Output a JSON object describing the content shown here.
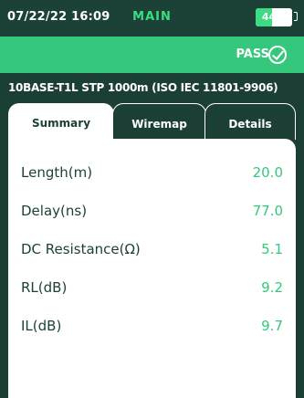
{
  "status_bar": {
    "datetime": "07/22/22 16:09",
    "mode": "MAIN",
    "battery_label": "44%",
    "battery_level": 0.44
  },
  "result": {
    "label": "PASS",
    "icon": "check-circle-icon",
    "color": "#35c87d"
  },
  "test_standard": "10BASE-T1L STP 1000m (ISO IEC 11801-9906)",
  "tabs": [
    {
      "label": "Summary",
      "active": true
    },
    {
      "label": "Wiremap",
      "active": false
    },
    {
      "label": "Details",
      "active": false
    }
  ],
  "summary": {
    "rows": [
      {
        "label": "Length(m)",
        "value": "20.0"
      },
      {
        "label": "Delay(ns)",
        "value": "77.0"
      },
      {
        "label": "DC Resistance(Ω)",
        "value": "5.1"
      },
      {
        "label": "RL(dB)",
        "value": "9.2"
      },
      {
        "label": "IL(dB)",
        "value": "9.7"
      }
    ]
  },
  "colors": {
    "background": "#1b3f35",
    "accent": "#35c87d",
    "text_dark": "#1b3f35"
  }
}
